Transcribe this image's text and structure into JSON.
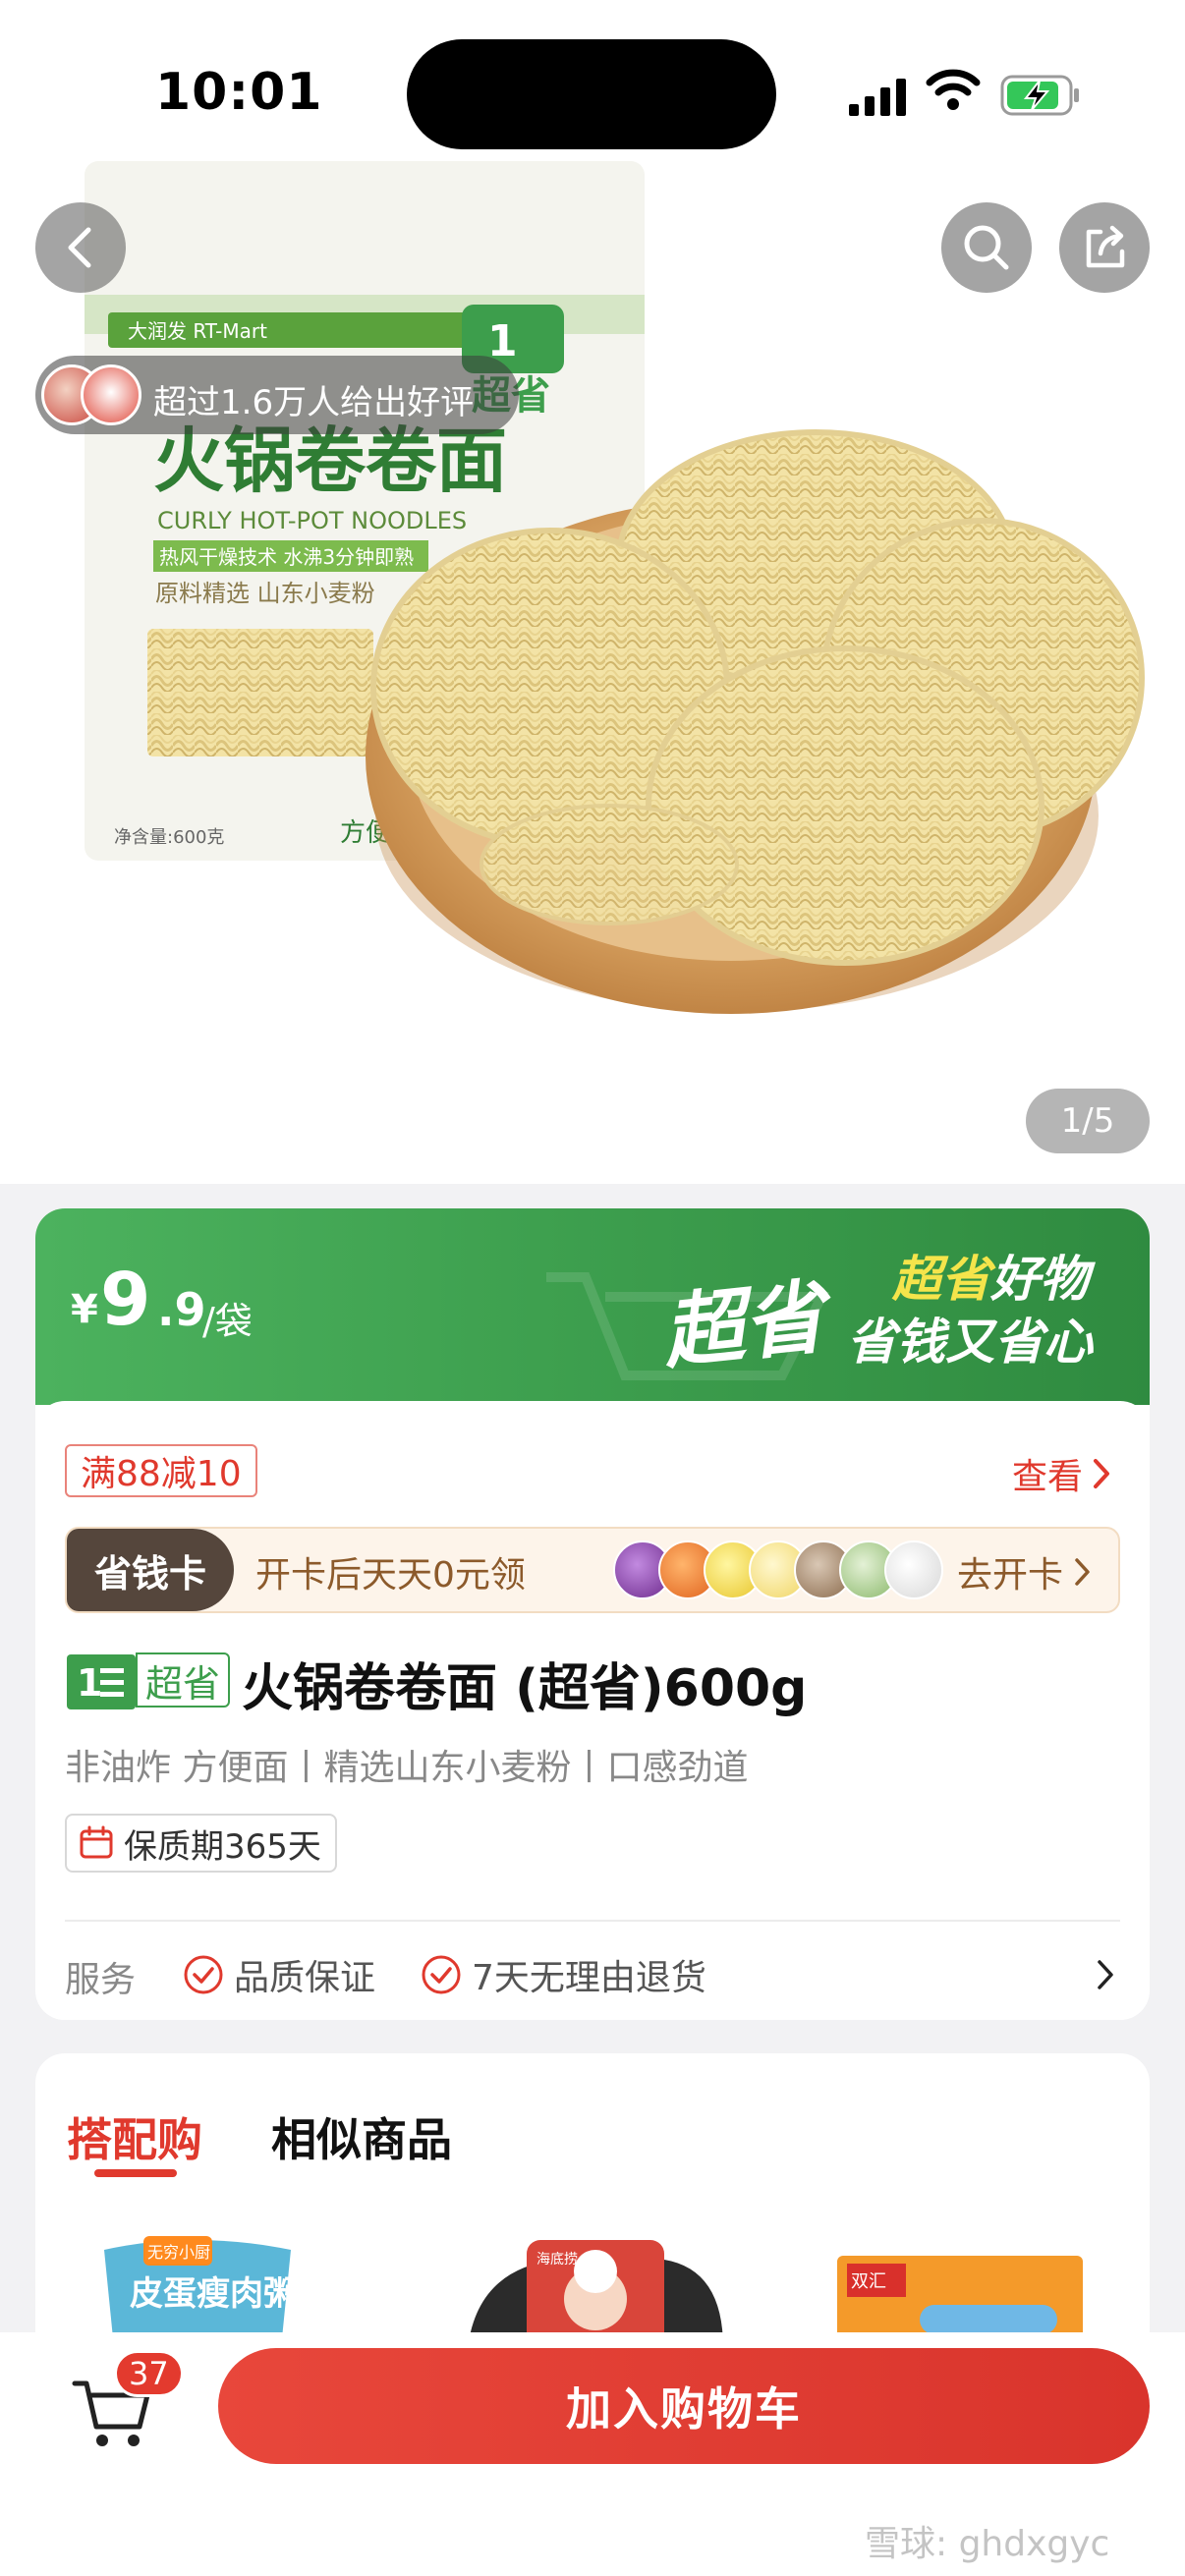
{
  "status_bar": {
    "time": "10:01"
  },
  "hero": {
    "review_text": "超过1.6万人给出好评",
    "page_indicator": "1/5",
    "package": {
      "brand_small": "大润发 RT-Mart",
      "title": "火锅卷卷面",
      "english": "CURLY HOT-POT NOODLES",
      "tagline": "热风干燥技术 水沸3分钟即熟",
      "seal": "原料精选 山东小麦粉",
      "net": "净含量:600克",
      "bottom_label": "方便面",
      "logo_text": "超省"
    }
  },
  "product": {
    "price": {
      "currency": "¥",
      "integer": "9",
      "decimal": ".9",
      "unit": "/袋"
    },
    "banner": {
      "brand_script": "超省",
      "slogan_yellow": "超省",
      "slogan_white": "好物",
      "slogan_line2": "省钱又省心"
    },
    "coupon": "满88减10",
    "view_label": "查看",
    "savings_card": {
      "tag": "省钱卡",
      "description": "开卡后天天0元领",
      "action": "去开卡"
    },
    "badge": "超省",
    "title": "火锅卷卷面 (超省)600g",
    "subtitle": "非油炸 方便面丨精选山东小麦粉丨口感劲道",
    "shelf_life": "保质期365天",
    "services": {
      "label": "服务",
      "items": [
        "品质保证",
        "7天无理由退货"
      ]
    }
  },
  "recommendations": {
    "tabs": [
      "搭配购",
      "相似商品"
    ],
    "item_texts": [
      "无穷小厨",
      "皮蛋瘦肉粥",
      "海底捞",
      "双汇"
    ]
  },
  "bottom_bar": {
    "cart_count": "37",
    "add_to_cart": "加入购物车"
  },
  "watermark": "雪球: ghdxgyc",
  "colors": {
    "accent_red": "#e0392d",
    "brand_green": "#3ea04f",
    "slogan_yellow": "#f5e44b"
  }
}
